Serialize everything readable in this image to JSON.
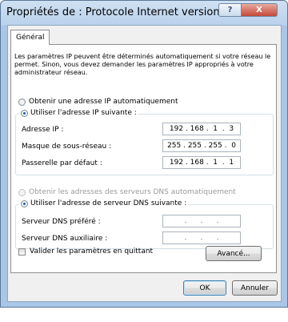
{
  "window": {
    "title": "Propriétés de : Protocole Internet version 4 (TC...",
    "help_label": "?",
    "close_label": "X"
  },
  "tab": {
    "label": "Général"
  },
  "intro": "Les paramètres IP peuvent être déterminés automatiquement si votre réseau le permet. Sinon, vous devez demander les paramètres IP appropriés à votre administrateur réseau.",
  "ip": {
    "auto_label": "Obtenir une adresse IP automatiquement",
    "manual_label": "Utiliser l'adresse IP suivante :",
    "selected": "manual",
    "fields": [
      {
        "label": "Adresse IP :",
        "value": "192 . 168 .  1  .  3"
      },
      {
        "label": "Masque de sous-réseau :",
        "value": "255 . 255 . 255 .  0"
      },
      {
        "label": "Passerelle par défaut :",
        "value": "192 . 168 .  1  .  1"
      }
    ]
  },
  "dns": {
    "auto_label": "Obtenir les adresses des serveurs DNS automatiquement",
    "auto_enabled": false,
    "manual_label": "Utiliser l'adresse de serveur DNS suivante :",
    "selected": "manual",
    "fields": [
      {
        "label": "Serveur DNS préféré :",
        "value": ".      .      ."
      },
      {
        "label": "Serveur DNS auxiliaire :",
        "value": ".      .      ."
      }
    ]
  },
  "validate": {
    "label": "Valider les paramètres en quittant",
    "checked": false
  },
  "buttons": {
    "advanced": "Avancé...",
    "ok": "OK",
    "cancel": "Annuler"
  }
}
